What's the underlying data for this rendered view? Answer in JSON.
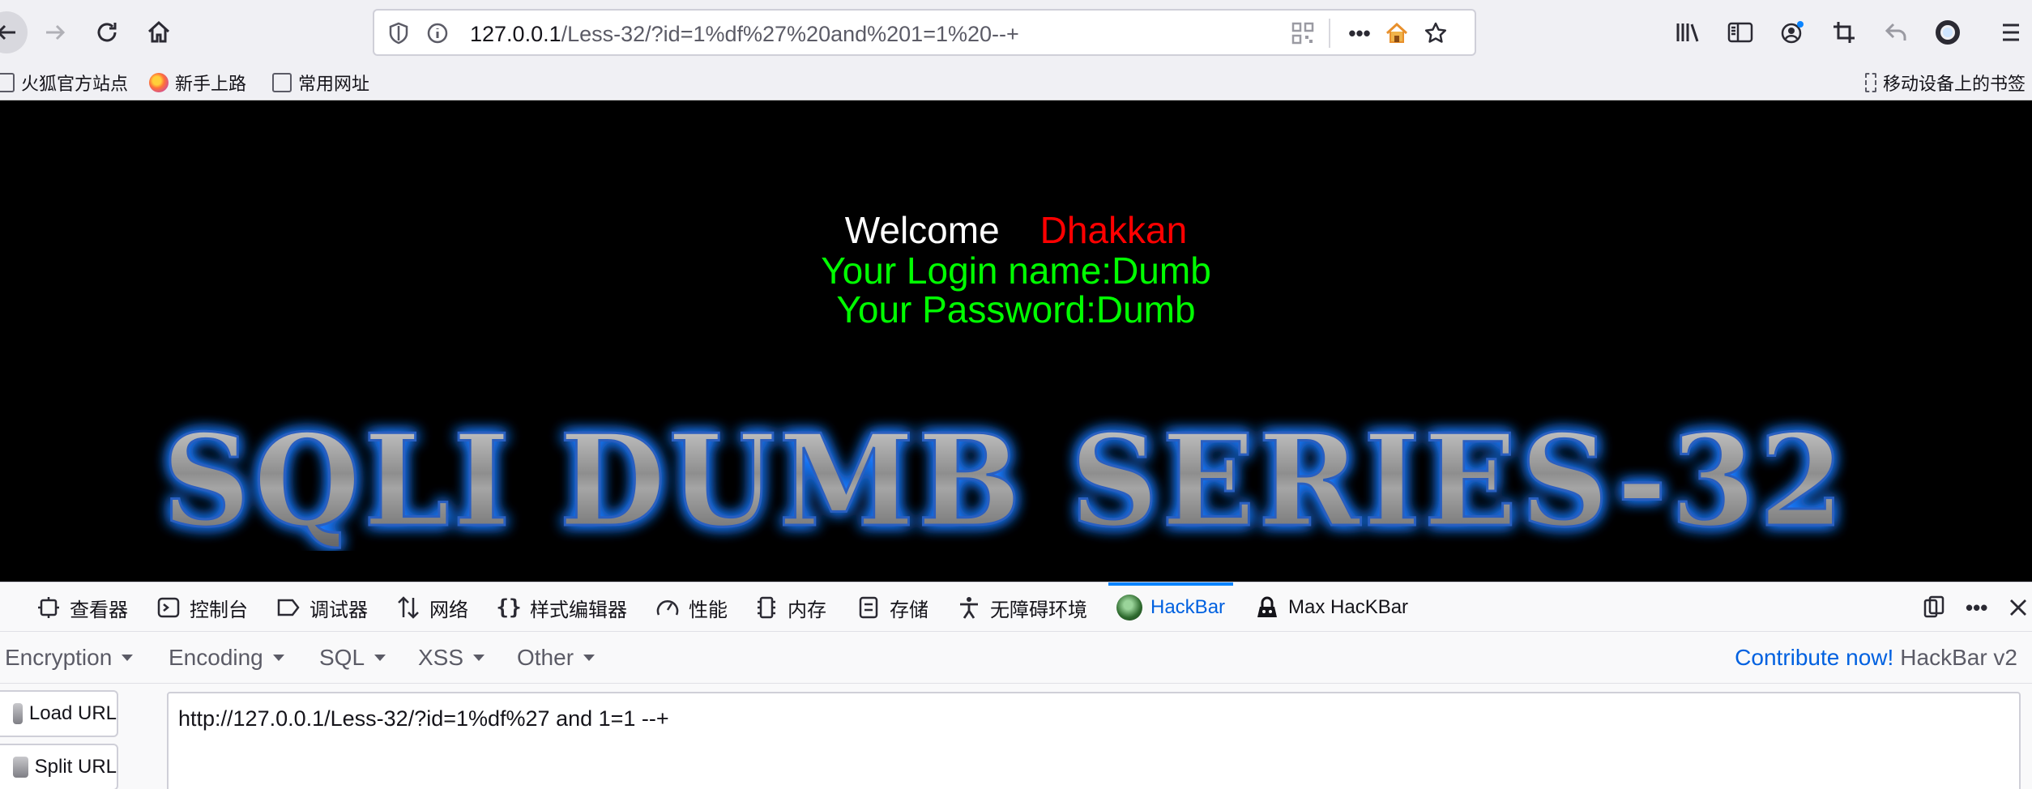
{
  "browser": {
    "url_host": "127.0.0.1",
    "url_path": "/Less-32/?id=1%df%27%20and%201=1%20--+",
    "icons": {
      "back": "back-arrow-icon",
      "forward": "forward-arrow-icon",
      "reload": "reload-icon",
      "home": "home-icon",
      "tracking": "shield-icon",
      "info": "info-icon",
      "qr": "qr-code-icon",
      "more": "more-dots-icon",
      "home_ext": "home-extension-icon",
      "bookmark": "star-icon",
      "library": "library-icon",
      "sidebar": "sidebar-icon",
      "account": "account-icon",
      "screenshot": "crop-icon",
      "undo": "undo-icon",
      "vpn": "ring-icon",
      "menu": "hamburger-menu-icon"
    }
  },
  "bookmarks": {
    "items": [
      {
        "label": "火狐官方站点",
        "icon": "folder-icon"
      },
      {
        "label": "新手上路",
        "icon": "firefox-icon"
      },
      {
        "label": "常用网址",
        "icon": "folder-icon"
      }
    ],
    "mobile": "移动设备上的书签"
  },
  "page": {
    "welcome": "Welcome",
    "name": "Dhakkan",
    "login": "Your Login name:Dumb",
    "password": "Your Password:Dumb",
    "banner": "SQLI DUMB SERIES-32"
  },
  "devtools": {
    "tabs": [
      {
        "label": "查看器",
        "icon": "inspector-icon"
      },
      {
        "label": "控制台",
        "icon": "console-icon"
      },
      {
        "label": "调试器",
        "icon": "debugger-icon"
      },
      {
        "label": "网络",
        "icon": "network-icon"
      },
      {
        "label": "样式编辑器",
        "icon": "style-editor-icon"
      },
      {
        "label": "性能",
        "icon": "performance-icon"
      },
      {
        "label": "内存",
        "icon": "memory-icon"
      },
      {
        "label": "存储",
        "icon": "storage-icon"
      },
      {
        "label": "无障碍环境",
        "icon": "accessibility-icon"
      },
      {
        "label": "HackBar",
        "icon": "hackbar-icon"
      },
      {
        "label": "Max HacKBar",
        "icon": "max-hackbar-icon"
      }
    ],
    "active_tab": "HackBar"
  },
  "hackbar": {
    "menu": [
      "Encryption",
      "Encoding",
      "SQL",
      "XSS",
      "Other"
    ],
    "contribute": "Contribute now!",
    "version": "HackBar v2",
    "load_url": "Load URL",
    "split_url": "Split URL",
    "url_value": "http://127.0.0.1/Less-32/?id=1%df%27 and 1=1 --+"
  },
  "colors": {
    "accent": "#0a84ff",
    "welcome_name": "#ff0000",
    "login_text": "#00ff00",
    "banner_glow": "#1e7bff"
  }
}
